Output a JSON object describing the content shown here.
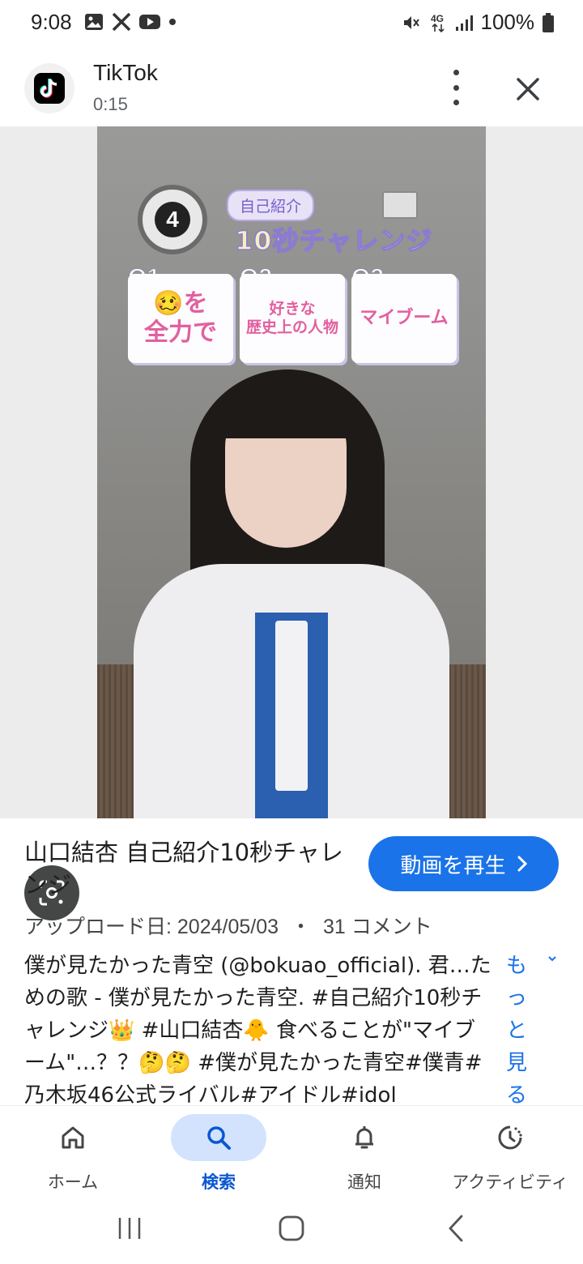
{
  "status_bar": {
    "time": "9:08",
    "network": "4G",
    "battery": "100%",
    "icons": [
      "gallery-icon",
      "x-icon",
      "youtube-icon",
      "dot-icon",
      "mute-icon",
      "signal-icon",
      "battery-icon"
    ]
  },
  "header": {
    "app_name": "TikTok",
    "duration": "0:15"
  },
  "video_overlay": {
    "timer_number": "4",
    "pill_text": "自己紹介",
    "challenge_title": "10秒チャレンジ",
    "questions": [
      {
        "label": "Q1.",
        "text_line1": "🥴を",
        "text_line2": "全力で"
      },
      {
        "label": "Q2.",
        "text_line1": "好きな",
        "text_line2": "歴史上の人物"
      },
      {
        "label": "Q3.",
        "text_line1": "マイブーム",
        "text_line2": ""
      }
    ]
  },
  "info": {
    "title": "山口結杏 自己紹介10秒チャレンジ",
    "play_button_label": "動画を再生",
    "upload_date_label": "アップロード日: 2024/05/03",
    "separator": "・",
    "comments": "31 コメント",
    "description": "僕が見たかった青空 (@bokuao_official). 君…ための歌 - 僕が見たかった青空. #自己紹介10秒チャレンジ👑 #山口結杏🐥 食べることが\"マイブーム\"…？？🤔🤔 #僕が見たかった青空#僕青#乃木坂46公式ライバル#アイドル#idol",
    "more_label": "もっと見る"
  },
  "bottom_nav": {
    "items": [
      {
        "label": "ホーム",
        "icon": "home-icon",
        "active": false
      },
      {
        "label": "検索",
        "icon": "search-icon",
        "active": true
      },
      {
        "label": "通知",
        "icon": "bell-icon",
        "active": false
      },
      {
        "label": "アクティビティ",
        "icon": "activity-icon",
        "active": false
      }
    ]
  },
  "colors": {
    "accent": "#1a73e8",
    "active_nav_bg": "#d3e3fd",
    "active_nav_text": "#0b57d0"
  }
}
